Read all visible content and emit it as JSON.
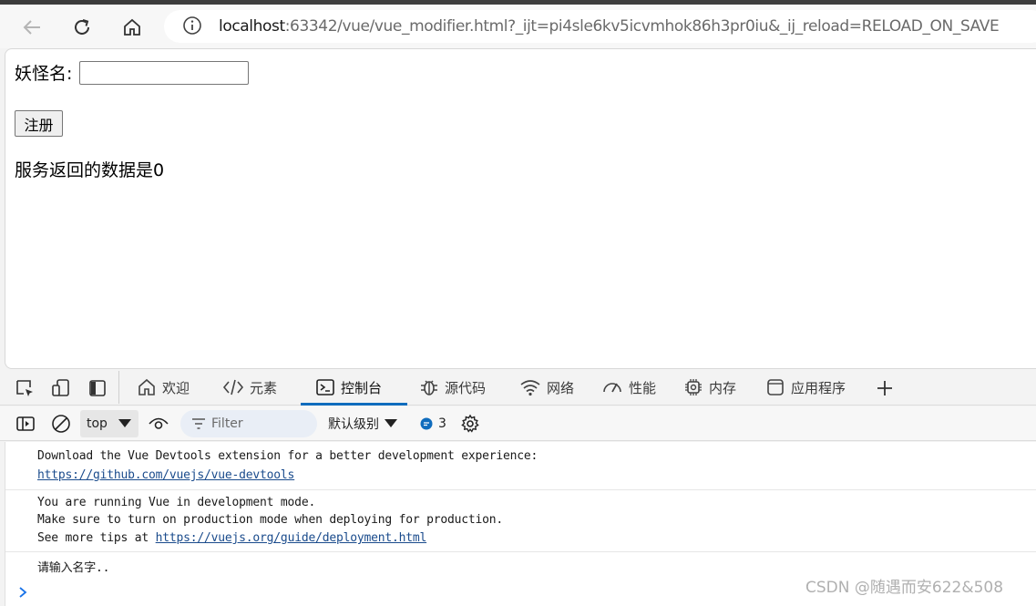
{
  "browser": {
    "url_host": "localhost",
    "url_rest": ":63342/vue/vue_modifier.html?_ijt=pi4sle6kv5icvmhok86h3pr0iu&_ij_reload=RELOAD_ON_SAVE"
  },
  "page": {
    "field_label": "妖怪名:",
    "field_value": "",
    "register_label": "注册",
    "result_text": "服务返回的数据是0"
  },
  "devtools": {
    "tabs": [
      {
        "label": "欢迎",
        "icon": "home-icon"
      },
      {
        "label": "元素",
        "icon": "code-icon"
      },
      {
        "label": "控制台",
        "icon": "console-icon",
        "active": true
      },
      {
        "label": "源代码",
        "icon": "bug-icon"
      },
      {
        "label": "网络",
        "icon": "wifi-icon"
      },
      {
        "label": "性能",
        "icon": "gauge-icon"
      },
      {
        "label": "内存",
        "icon": "chip-icon"
      },
      {
        "label": "应用程序",
        "icon": "app-icon"
      }
    ],
    "context": "top",
    "filter_placeholder": "Filter",
    "level": "默认级别",
    "issues_count": "3",
    "active_color": "#0f6cbd"
  },
  "console": {
    "messages": [
      {
        "lines": [
          "Download the Vue Devtools extension for a better development experience:"
        ],
        "link": "https://github.com/vuejs/vue-devtools"
      },
      {
        "lines": [
          "You are running Vue in development mode.",
          "Make sure to turn on production mode when deploying for production."
        ],
        "tip_prefix": "See more tips at ",
        "link": "https://vuejs.org/guide/deployment.html"
      },
      {
        "lines": [
          "请输入名字.."
        ]
      }
    ]
  },
  "watermark": "CSDN @随遇而安622&508"
}
